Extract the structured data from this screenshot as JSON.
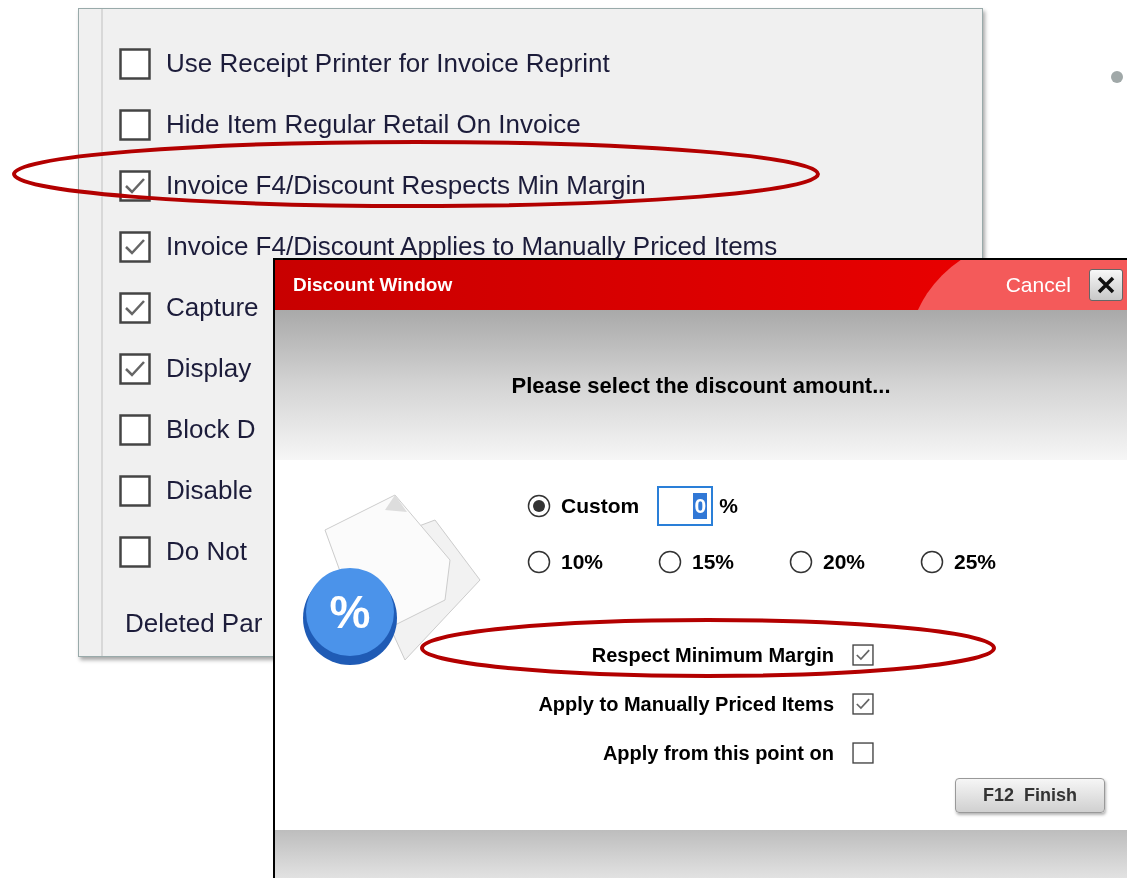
{
  "settings_panel": {
    "options": [
      {
        "label": "Use Receipt Printer for Invoice Reprint",
        "checked": false
      },
      {
        "label": "Hide Item Regular Retail On Invoice",
        "checked": false
      },
      {
        "label": "Invoice F4/Discount Respects Min Margin",
        "checked": true
      },
      {
        "label": "Invoice F4/Discount Applies to Manually Priced Items",
        "checked": true
      },
      {
        "label": "Capture",
        "checked": true
      },
      {
        "label": "Display",
        "checked": true
      },
      {
        "label": "Block D",
        "checked": false
      },
      {
        "label": "Disable",
        "checked": false
      },
      {
        "label": "Do Not",
        "checked": false
      }
    ],
    "footer_label": "Deleted Par"
  },
  "dialog": {
    "title": "Discount Window",
    "cancel": "Cancel",
    "prompt": "Please select the discount amount...",
    "custom": {
      "label": "Custom",
      "selected": true,
      "value": "0",
      "unit": "%"
    },
    "presets": [
      {
        "label": "10%",
        "selected": false
      },
      {
        "label": "15%",
        "selected": false
      },
      {
        "label": "20%",
        "selected": false
      },
      {
        "label": "25%",
        "selected": false
      }
    ],
    "options": [
      {
        "label": "Respect Minimum Margin",
        "checked": true
      },
      {
        "label": "Apply to Manually Priced Items",
        "checked": true
      },
      {
        "label": "Apply from this point on",
        "checked": false
      }
    ],
    "finish_button": "F12  Finish",
    "icon_symbol": "%"
  }
}
